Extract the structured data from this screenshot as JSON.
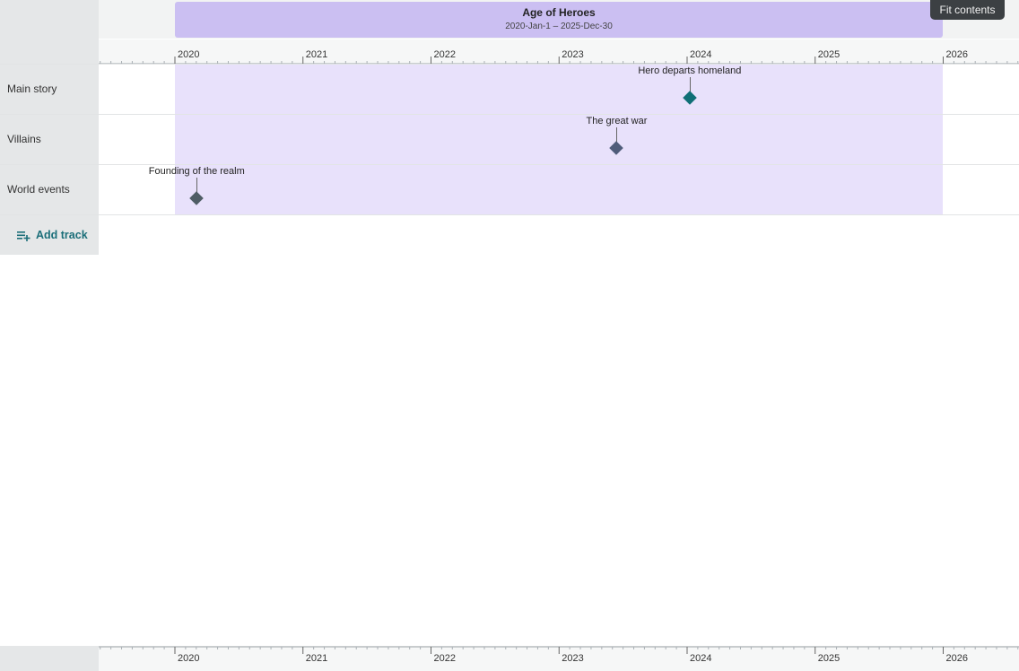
{
  "era": {
    "title": "Age of Heroes",
    "range": "2020-Jan-1 – 2025-Dec-30",
    "start": 2020.0,
    "end": 2026.0,
    "color": "#cbbff2",
    "band_color": "#e8e1fb"
  },
  "toolbar": {
    "fit_label": "Fit contents"
  },
  "axis": {
    "years": [
      "2020",
      "2021",
      "2022",
      "2023",
      "2024",
      "2025",
      "2026"
    ],
    "start_year": 2020,
    "minor_per_year": 12
  },
  "tracks": [
    {
      "label": "Main story"
    },
    {
      "label": "Villains"
    },
    {
      "label": "World events"
    }
  ],
  "add_track": {
    "label": "Add track",
    "icon": "playlist-add-icon"
  },
  "events": [
    {
      "label": "Hero departs homeland",
      "track": 0,
      "date": 2024.02,
      "color": "#0f6f76"
    },
    {
      "label": "The great war",
      "track": 1,
      "date": 2023.45,
      "color": "#4f5c7a"
    },
    {
      "label": "Founding of the realm",
      "track": 2,
      "date": 2020.17,
      "color": "#4f5d65"
    }
  ]
}
